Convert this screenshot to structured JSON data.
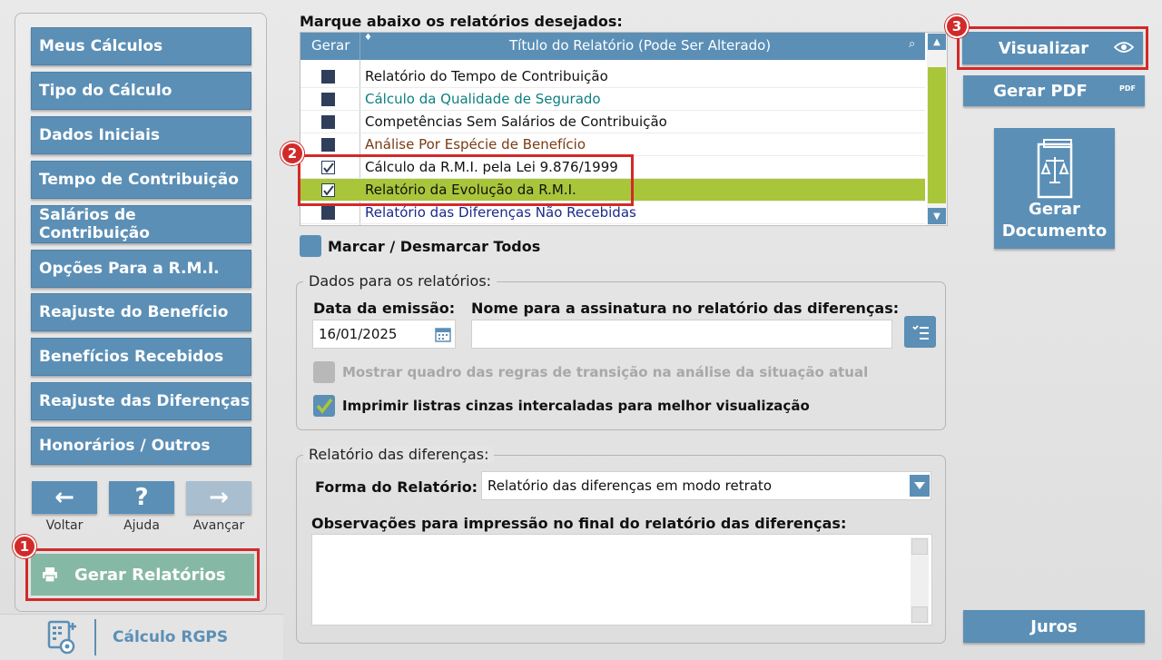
{
  "nav": {
    "items": [
      {
        "label": "Meus Cálculos"
      },
      {
        "label": "Tipo do Cálculo"
      },
      {
        "label": "Dados Iniciais"
      },
      {
        "label": "Tempo de Contribuição"
      },
      {
        "label": "Salários de Contribuição"
      },
      {
        "label": "Opções Para a R.M.I."
      },
      {
        "label": "Reajuste do Benefício"
      },
      {
        "label": "Benefícios Recebidos"
      },
      {
        "label": "Reajuste das Diferenças"
      },
      {
        "label": "Honorários / Outros"
      }
    ],
    "back": {
      "glyph": "←",
      "label": "Voltar"
    },
    "help": {
      "glyph": "?",
      "label": "Ajuda"
    },
    "forward": {
      "glyph": "→",
      "label": "Avançar"
    },
    "generate_label": "Gerar Relatórios",
    "product_name": "Cálculo RGPS"
  },
  "badges": {
    "one": "1",
    "two": "2",
    "three": "3"
  },
  "reports": {
    "heading": "Marque abaixo os relatórios desejados:",
    "col_generate": "Gerar",
    "col_title": "Título do Relatório (Pode Ser Alterado)",
    "rows": [
      {
        "title": "Relatório do Tempo de Contribuição",
        "checked": false,
        "color": "#111111"
      },
      {
        "title": "Cálculo da Qualidade de Segurado",
        "checked": false,
        "color": "#0d7f7f"
      },
      {
        "title": "Competências Sem Salários de Contribuição",
        "checked": false,
        "color": "#111111"
      },
      {
        "title": "Análise Por Espécie de Benefício",
        "checked": false,
        "color": "#7a3b12"
      },
      {
        "title": "Cálculo da R.M.I. pela Lei 9.876/1999",
        "checked": true,
        "color": "#111111"
      },
      {
        "title": "Relatório da Evolução da R.M.I.",
        "checked": true,
        "color": "#111111",
        "selected": true
      },
      {
        "title": "Relatório das Diferenças Não Recebidas",
        "checked": false,
        "color": "#1a2a8a"
      }
    ],
    "toggle_all_label": "Marcar / Desmarcar Todos"
  },
  "dados": {
    "legend": "Dados para os relatórios:",
    "emission_label": "Data da emissão:",
    "emission_value": "16/01/2025",
    "signature_label": "Nome para a assinatura no relatório das diferenças:",
    "signature_value": "",
    "transition_rules_label": "Mostrar quadro das regras de transição na análise da situação atual",
    "gray_stripes_label": "Imprimir listras cinzas intercaladas para melhor visualização"
  },
  "diferencas": {
    "legend": "Relatório das diferenças:",
    "form_label": "Forma do Relatório:",
    "form_value": "Relatório das diferenças em modo retrato",
    "obs_label": "Observações para impressão no final do relatório das diferenças:",
    "obs_value": ""
  },
  "right": {
    "visualize_label": "Visualizar",
    "pdf_label": "Gerar PDF",
    "pdf_tag": "PDF",
    "document_line1": "Gerar",
    "document_line2": "Documento",
    "interest_label": "Juros"
  },
  "colors": {
    "accent": "#5b8fb6",
    "selected_row": "#a9c63a",
    "highlight": "#d12a2a",
    "generate": "#86b9a5"
  }
}
